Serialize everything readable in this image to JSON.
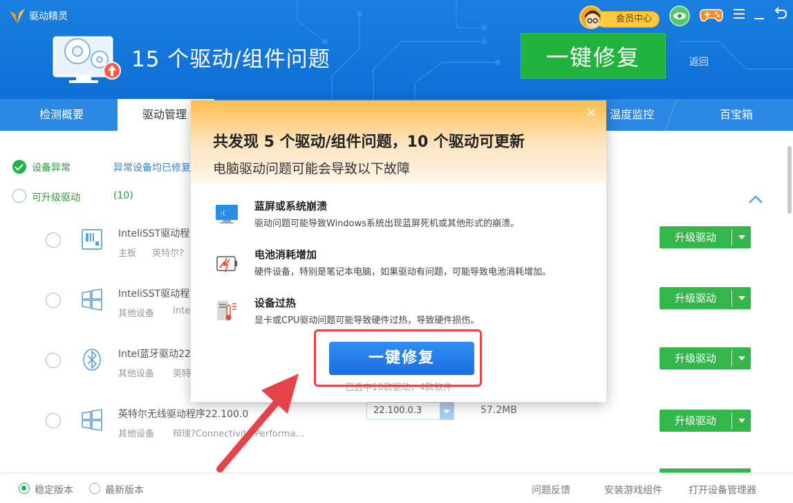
{
  "app": {
    "title": "驱动精灵"
  },
  "header": {
    "headline": "15 个驱动/组件问题",
    "fix_button": "一键修复",
    "back_link": "返回",
    "vip_center": "会员中心"
  },
  "tabs": [
    {
      "label": "检测概要",
      "active": false
    },
    {
      "label": "驱动管理",
      "active": true
    },
    {
      "label": "温度监控",
      "active": false
    },
    {
      "label": "百宝箱",
      "active": false
    }
  ],
  "sections": {
    "abnormal": {
      "label": "设备异常",
      "note": "异常设备均已修复"
    },
    "upgradable": {
      "label": "可升级驱动",
      "count": "(10)"
    }
  },
  "drivers": [
    {
      "name": "InteliSST驱动程",
      "category": "主板",
      "vendor": "英特尔?",
      "icon": "chipset-icon",
      "action": "升级驱动"
    },
    {
      "name": "InteliSST驱动程",
      "category": "其他设备",
      "vendor": "Inte",
      "icon": "windows-icon",
      "action": "升级驱动"
    },
    {
      "name": "Intel蓝牙驱动22",
      "category": "其他设备",
      "vendor": "英特",
      "icon": "bluetooth-icon",
      "action": "升级驱动"
    },
    {
      "name": "英特尔无线驱动程序22.100.0",
      "category": "其他设备",
      "vendor": "辩瑰?Connectivity Performa...",
      "icon": "windows-icon",
      "action": "升级驱动",
      "version": "22.100.0.3",
      "size": "57.2MB"
    }
  ],
  "footer": {
    "stable": "稳定版本",
    "latest": "最新版本",
    "links": [
      "问题反馈",
      "安装游戏组件",
      "打开设备管理器"
    ]
  },
  "modal": {
    "title": "共发现 5 个驱动/组件问题，10 个驱动可更新",
    "subtitle": "电脑驱动问题可能会导致以下故障",
    "issues": [
      {
        "title": "蓝屏或系统崩溃",
        "desc": "驱动问题可能导致Windows系统出现蓝屏死机或其他形式的崩溃。",
        "icon": "bluescreen-icon"
      },
      {
        "title": "电池消耗增加",
        "desc": "硬件设备，特别是笔记本电脑，如果驱动有问题，可能导致电池消耗增加。",
        "icon": "battery-icon"
      },
      {
        "title": "设备过热",
        "desc": "显卡或CPU驱动问题可能导致硬件过热，导致硬件损伤。",
        "icon": "overheat-icon"
      }
    ],
    "fix_button": "一键修复",
    "footnote": "已选中10款驱动，4款软件"
  },
  "colors": {
    "header_blue": "#1a7fe0",
    "fix_green": "#22b33e",
    "upgrade_green": "#34b74a",
    "modal_orange": "#fdbd4b",
    "modal_button_blue": "#1a6ee2",
    "highlight_red": "#e5424a"
  }
}
